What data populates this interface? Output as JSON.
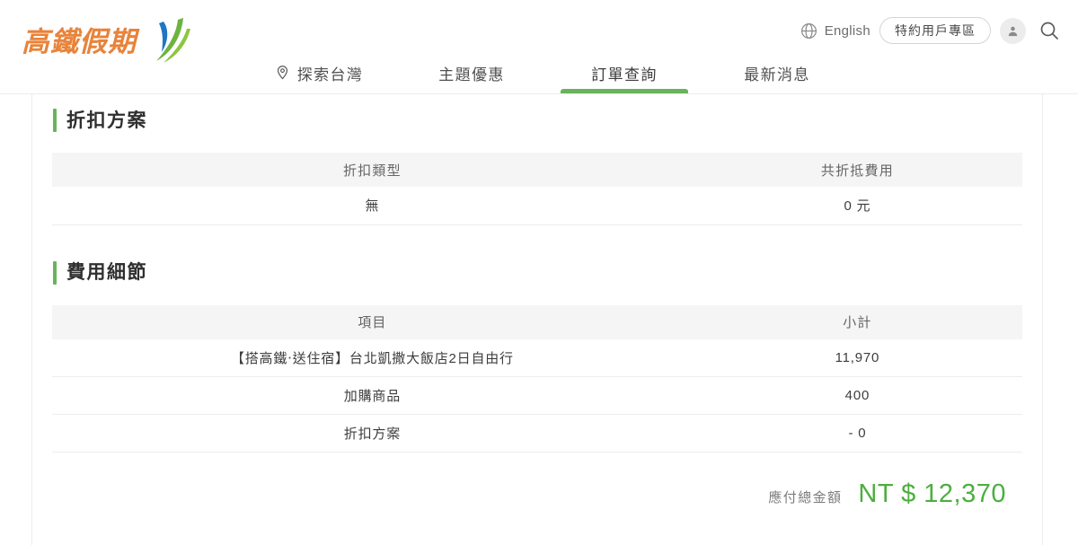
{
  "header": {
    "logo_text": "高鐵假期",
    "logo_icon": "swoosh-logo-icon",
    "utility": {
      "globe_icon": "globe-icon",
      "language_label": "English",
      "member_zone_label": "特約用戶專區",
      "avatar_icon": "user-avatar-icon",
      "search_icon": "search-icon"
    },
    "nav": [
      {
        "label": "探索台灣",
        "icon": "location-pin-icon",
        "active": false
      },
      {
        "label": "主題優惠",
        "icon": "",
        "active": false
      },
      {
        "label": "訂單查詢",
        "icon": "",
        "active": true
      },
      {
        "label": "最新消息",
        "icon": "",
        "active": false
      }
    ]
  },
  "sections": {
    "discount": {
      "title": "折扣方案",
      "columns": [
        "折扣類型",
        "共折抵費用"
      ],
      "rows": [
        {
          "type": "無",
          "amount": "0 元"
        }
      ]
    },
    "fee": {
      "title": "費用細節",
      "columns": [
        "項目",
        "小計"
      ],
      "rows": [
        {
          "item": "【搭高鐵‧送住宿】台北凱撒大飯店2日自由行",
          "subtotal": "11,970"
        },
        {
          "item": "加購商品",
          "subtotal": "400"
        },
        {
          "item": "折扣方案",
          "subtotal": "- 0"
        }
      ],
      "total_label": "應付總金額",
      "total_value": "NT $ 12,370"
    }
  },
  "colors": {
    "accent_green": "#68b35b",
    "total_green": "#4caf3f",
    "logo_orange": "#e8833a",
    "table_header_bg": "#f5f5f5"
  }
}
